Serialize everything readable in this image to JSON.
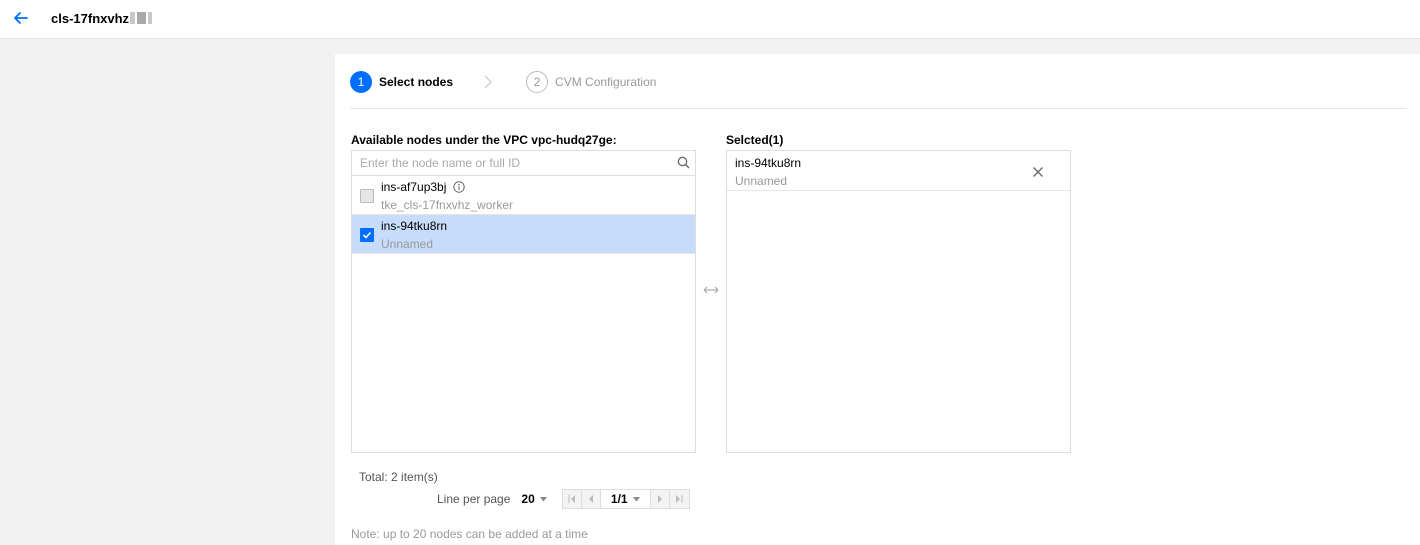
{
  "header": {
    "cluster_id": "cls-17fnxvhz",
    "back_icon": "arrow-left-icon"
  },
  "steps": [
    {
      "number": "1",
      "label": "Select nodes",
      "state": "active"
    },
    {
      "number": "2",
      "label": "CVM Configuration",
      "state": "idle"
    }
  ],
  "available": {
    "title": "Available nodes under the VPC vpc-hudq27ge:",
    "search_placeholder": "Enter the node name or full ID",
    "items": [
      {
        "id": "ins-af7up3bj",
        "name": "tke_cls-17fnxvhz_worker",
        "checked": false,
        "disabled": true,
        "info_icon": true
      },
      {
        "id": "ins-94tku8rn",
        "name": "Unnamed",
        "checked": true,
        "disabled": false,
        "info_icon": false
      }
    ]
  },
  "selected": {
    "title": "Selcted(1)",
    "items": [
      {
        "id": "ins-94tku8rn",
        "name": "Unnamed"
      }
    ]
  },
  "pagination": {
    "total_label": "Total: 2 item(s)",
    "per_page_label": "Line per page",
    "per_page_value": "20",
    "page_indicator": "1/1"
  },
  "note": "Note: up to 20 nodes can be added at a time",
  "colors": {
    "accent": "#006eff",
    "selected_row": "#c7dcfb",
    "page_bg": "#f2f2f2"
  }
}
